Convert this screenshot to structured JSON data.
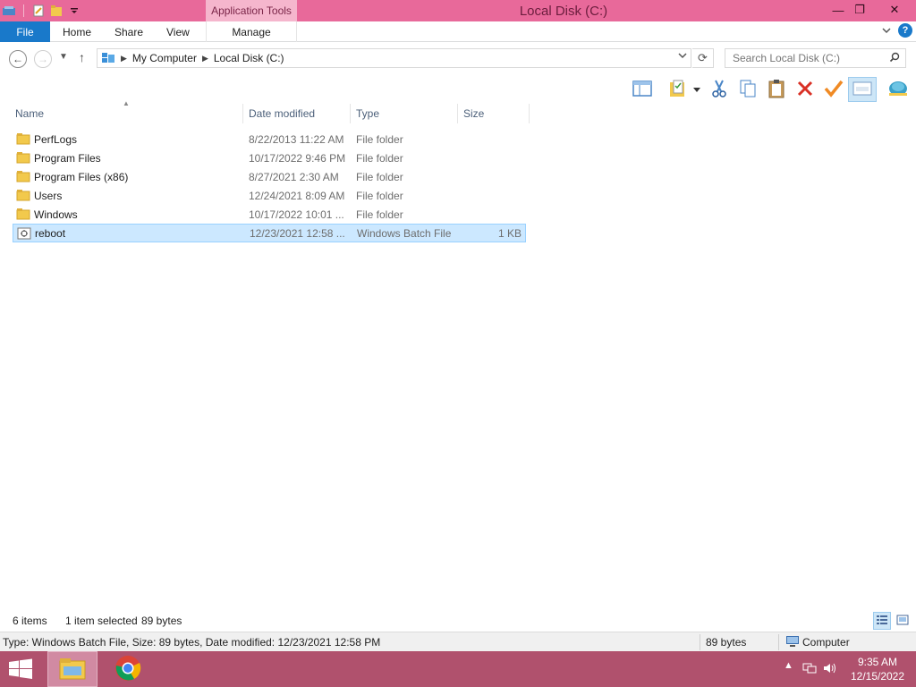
{
  "window": {
    "title": "Local Disk (C:)",
    "context_tab_group": "Application Tools",
    "controls": {
      "minimize": "—",
      "maximize": "❐",
      "close": "✕"
    }
  },
  "ribbon": {
    "tabs": [
      {
        "label": "File"
      },
      {
        "label": "Home"
      },
      {
        "label": "Share"
      },
      {
        "label": "View"
      },
      {
        "label": "Manage"
      }
    ]
  },
  "address_bar": {
    "breadcrumbs": [
      "My Computer",
      "Local Disk (C:)"
    ],
    "search_placeholder": "Search Local Disk (C:)"
  },
  "toolbar": {
    "icons": [
      "preview-pane-icon",
      "properties-folder-icon",
      "cut-icon",
      "copy-icon",
      "paste-icon",
      "delete-icon",
      "check-icon",
      "view-icon",
      "network-icon"
    ]
  },
  "columns": {
    "name": "Name",
    "date": "Date modified",
    "type": "Type",
    "size": "Size"
  },
  "files": [
    {
      "name": "PerfLogs",
      "date": "8/22/2013 11:22 AM",
      "type": "File folder",
      "size": "",
      "kind": "folder",
      "selected": false
    },
    {
      "name": "Program Files",
      "date": "10/17/2022 9:46 PM",
      "type": "File folder",
      "size": "",
      "kind": "folder",
      "selected": false
    },
    {
      "name": "Program Files (x86)",
      "date": "8/27/2021 2:30 AM",
      "type": "File folder",
      "size": "",
      "kind": "folder",
      "selected": false
    },
    {
      "name": "Users",
      "date": "12/24/2021 8:09 AM",
      "type": "File folder",
      "size": "",
      "kind": "folder",
      "selected": false
    },
    {
      "name": "Windows",
      "date": "10/17/2022 10:01 ...",
      "type": "File folder",
      "size": "",
      "kind": "folder",
      "selected": false
    },
    {
      "name": "reboot",
      "date": "12/23/2021 12:58 ...",
      "type": "Windows Batch File",
      "size": "1 KB",
      "kind": "batch",
      "selected": true
    }
  ],
  "status": {
    "item_count": "6 items",
    "selection": "1 item selected",
    "selection_size": "89 bytes"
  },
  "details_bar": {
    "info": "Type: Windows Batch File, Size: 89 bytes, Date modified: 12/23/2021 12:58 PM",
    "size": "89 bytes",
    "location": "Computer"
  },
  "taskbar": {
    "time": "9:35 AM",
    "date": "12/15/2022"
  },
  "colors": {
    "titlebar": "#e8699a",
    "file_tab": "#1979ca",
    "taskbar": "#b0516d",
    "selection": "#cce8ff"
  }
}
